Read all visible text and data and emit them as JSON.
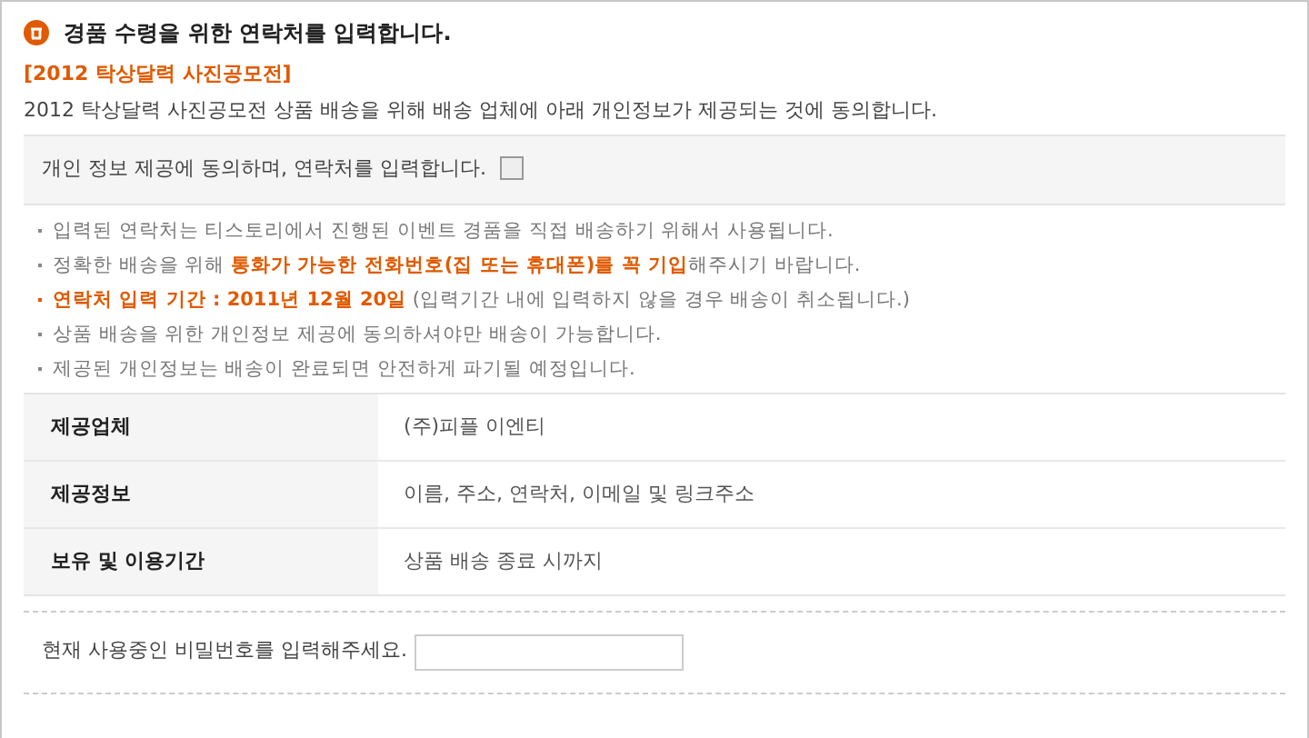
{
  "title": "경품 수령을 위한 연락처를 입력합니다.",
  "event_name": "[2012 탁상달력 사진공모전]",
  "description": "2012 탁상달력 사진공모전 상품 배송을 위해 배송 업체에 아래 개인정보가 제공되는 것에 동의합니다.",
  "consent": {
    "label": "개인 정보 제공에 동의하며, 연락처를 입력합니다.",
    "checked": false
  },
  "notes": [
    {
      "kind": "plain",
      "text": "입력된 연락처는 티스토리에서 진행된 이벤트 경품을 직접 배송하기 위해서 사용됩니다."
    },
    {
      "kind": "plain",
      "text": "정확한 배송을 위해 **통화가 가능한 전화번호(집 또는 휴대폰)를 꼭 기입**해주시기 바랍니다."
    },
    {
      "kind": "highlight",
      "text": "**연락처 입력 기간 : 2011년 12월 20일** (입력기간 내에 입력하지 않을 경우 배송이 취소됩니다.)"
    },
    {
      "kind": "plain",
      "text": "상품 배송을 위한 개인정보 제공에 동의하셔야만 배송이 가능합니다."
    },
    {
      "kind": "plain",
      "text": "제공된 개인정보는 배송이 완료되면 안전하게 파기될 예정입니다."
    }
  ],
  "table": {
    "rows": [
      {
        "label": "제공업체",
        "value": "(주)피플 이엔티"
      },
      {
        "label": "제공정보",
        "value": "이름, 주소, 연락처, 이메일 및 링크주소"
      },
      {
        "label": "보유 및 이용기간",
        "value": "상품 배송 종료 시까지"
      }
    ]
  },
  "password": {
    "label": "현재 사용중인 비밀번호를 입력해주세요."
  }
}
